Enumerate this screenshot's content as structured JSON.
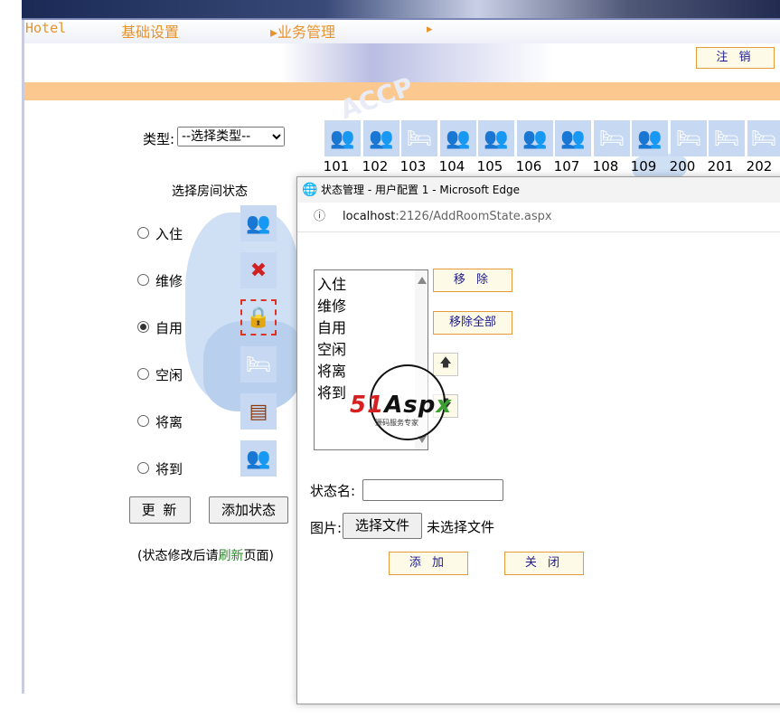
{
  "nav": {
    "hotel": "Hotel",
    "basic_settings": "基础设置",
    "business_management": "▸业务管理",
    "marker": "▸"
  },
  "header": {
    "logout": "注 销"
  },
  "filter": {
    "type_label": "类型:",
    "type_selected": "--选择类型--"
  },
  "status_panel": {
    "title": "选择房间状态",
    "items": [
      {
        "label": "入住",
        "icon": "guests-icon",
        "checked": false
      },
      {
        "label": "维修",
        "icon": "repair-icon",
        "checked": false
      },
      {
        "label": "自用",
        "icon": "lock-icon",
        "checked": true
      },
      {
        "label": "空闲",
        "icon": "bed-icon",
        "checked": false
      },
      {
        "label": "将离",
        "icon": "checkout-icon",
        "checked": false
      },
      {
        "label": "将到",
        "icon": "arriving-icon",
        "checked": false
      }
    ],
    "update_button": "更 新",
    "add_status_button": "添加状态",
    "hint_prefix": "(状态修改后请",
    "hint_refresh": "刷新",
    "hint_suffix": "页面)"
  },
  "rooms": [
    {
      "number": "101",
      "icon": "guests-icon"
    },
    {
      "number": "102",
      "icon": "guests-icon"
    },
    {
      "number": "103",
      "icon": "bed-icon"
    },
    {
      "number": "104",
      "icon": "guests-icon"
    },
    {
      "number": "105",
      "icon": "guests-icon"
    },
    {
      "number": "106",
      "icon": "guests-icon"
    },
    {
      "number": "107",
      "icon": "guests-icon"
    },
    {
      "number": "108",
      "icon": "bed-icon"
    },
    {
      "number": "109",
      "icon": "guests-icon"
    },
    {
      "number": "200",
      "icon": "bed-icon"
    },
    {
      "number": "201",
      "icon": "bed-icon"
    },
    {
      "number": "202",
      "icon": "bed-icon"
    }
  ],
  "popup": {
    "title": "状态管理 - 用户配置 1 - Microsoft Edge",
    "address_host": "localhost",
    "address_path": ":2126/AddRoomState.aspx",
    "state_list": [
      "入住",
      "维修",
      "自用",
      "空闲",
      "将离",
      "将到"
    ],
    "remove_button": "移 除",
    "remove_all_button": "移除全部",
    "name_label": "状态名:",
    "name_value": "",
    "picture_label": "图片:",
    "choose_file_button": "选择文件",
    "file_status": "未选择文件",
    "add_button": "添 加",
    "close_button": "关 闭"
  },
  "watermark": {
    "brand_red": "51",
    "brand_black": "Asp",
    "brand_green": "x",
    "tagline": "源码服务专家"
  }
}
